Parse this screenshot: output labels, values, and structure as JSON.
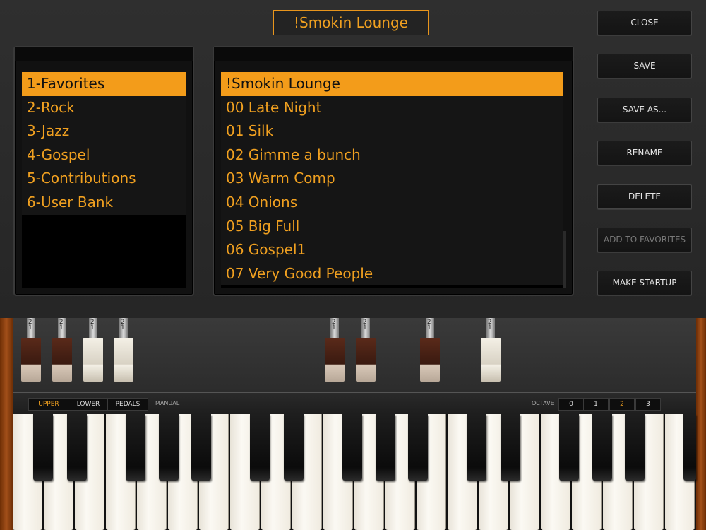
{
  "preset": {
    "title": "!Smokin Lounge"
  },
  "banks": [
    {
      "label": "1-Favorites",
      "selected": true
    },
    {
      "label": "2-Rock",
      "selected": false
    },
    {
      "label": "3-Jazz",
      "selected": false
    },
    {
      "label": "4-Gospel",
      "selected": false
    },
    {
      "label": "5-Contributions",
      "selected": false
    },
    {
      "label": "6-User Bank",
      "selected": false
    }
  ],
  "patches": [
    {
      "label": "!Smokin Lounge",
      "selected": true
    },
    {
      "label": "00 Late Night",
      "selected": false
    },
    {
      "label": "01 Silk",
      "selected": false
    },
    {
      "label": "02 Gimme a bunch",
      "selected": false
    },
    {
      "label": "03 Warm Comp",
      "selected": false
    },
    {
      "label": "04 Onions",
      "selected": false
    },
    {
      "label": "05 Big Full",
      "selected": false
    },
    {
      "label": "06 Gospel1",
      "selected": false
    },
    {
      "label": "07 Very Good People",
      "selected": false
    }
  ],
  "actions": {
    "close": "CLOSE",
    "save": "SAVE",
    "save_as": "SAVE AS...",
    "rename": "RENAME",
    "delete": "DELETE",
    "add_to_favorites": "ADD TO FAVORITES",
    "make_startup": "MAKE STARTUP"
  },
  "drawbars": {
    "number_label": "21",
    "items": [
      {
        "color": "brown"
      },
      {
        "color": "brown"
      },
      {
        "color": "white"
      },
      {
        "color": "white"
      },
      {
        "color": "brown"
      },
      {
        "color": "brown"
      },
      {
        "color": "brown"
      },
      {
        "color": "white"
      }
    ]
  },
  "manual": {
    "label": "MANUAL",
    "options": [
      "UPPER",
      "LOWER",
      "PEDALS"
    ],
    "selected": "UPPER"
  },
  "octave": {
    "label": "OCTAVE",
    "options": [
      "0",
      "1",
      "2",
      "3"
    ],
    "selected": "2"
  },
  "colors": {
    "accent": "#f39c1a",
    "list_bg": "#151515",
    "panel_bg": "#2a2a2a"
  }
}
